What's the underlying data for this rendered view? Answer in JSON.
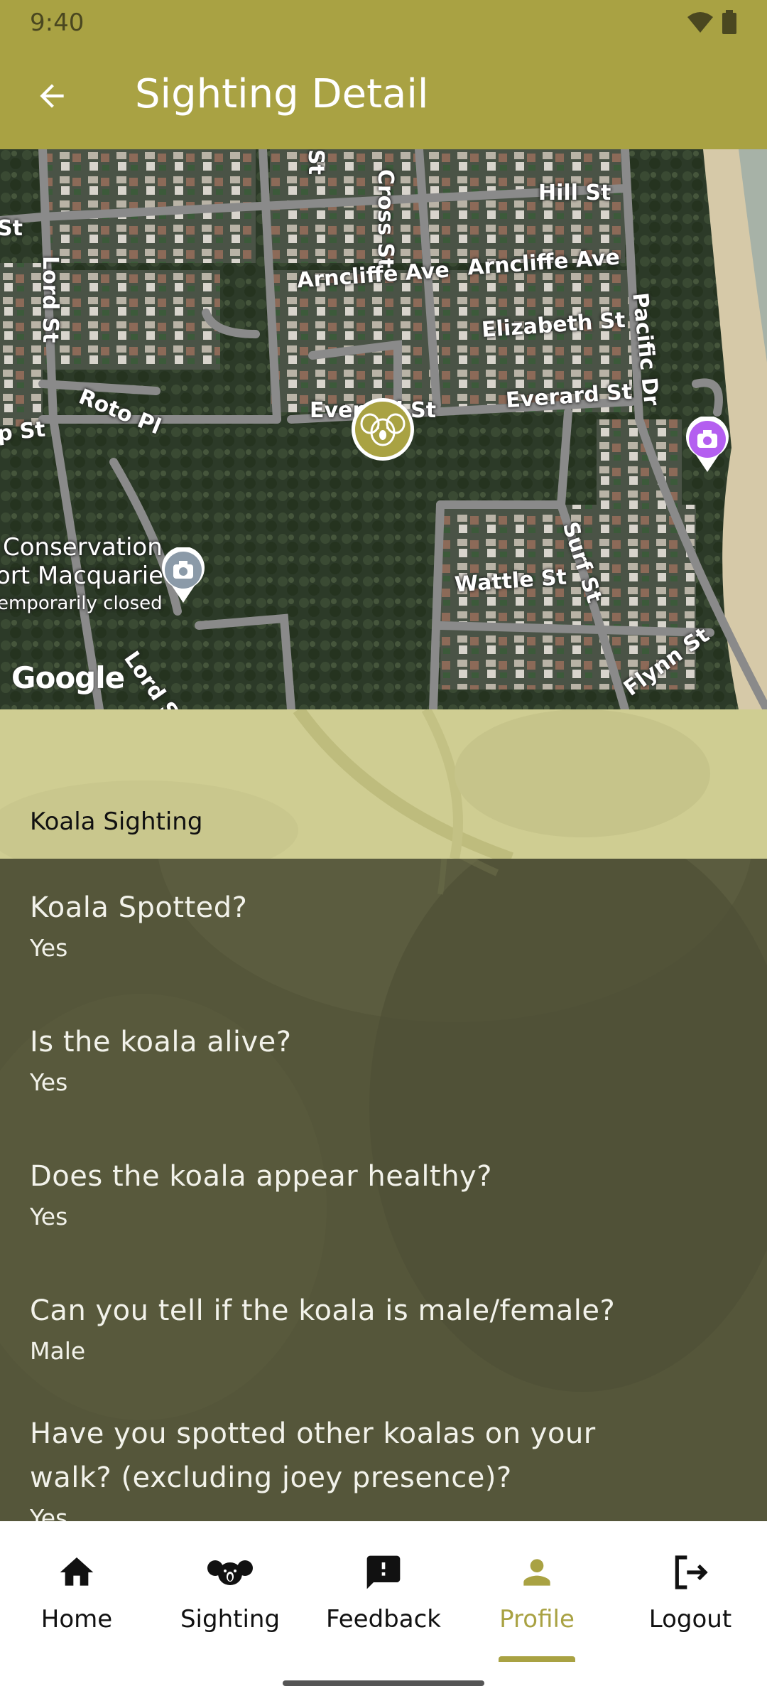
{
  "status_bar": {
    "time": "9:40"
  },
  "header": {
    "title": "Sighting Detail"
  },
  "map": {
    "labels": {
      "hill_st": "Hill St",
      "cross_st": "Cross St",
      "arncliffe_ave_1": "Arncliffe Ave",
      "arncliffe_ave_2": "Arncliffe Ave",
      "elizabeth_st": "Elizabeth St",
      "pacific_dr": "Pacific Dr",
      "lord_st_1": "Lord St",
      "lord_st_2": "Lord St",
      "roto_pl": "Roto Pl",
      "everard_st_1": "Everard St",
      "everard_st_2": "Everard St",
      "p_st": "p St",
      "wattle_st": "Wattle St",
      "surf_st": "Surf St",
      "flynn_st": "Flynn St",
      "st_left": "St",
      "st_top": "St",
      "poi_name_1": "Conservation",
      "poi_name_2": "ort Macquarie",
      "poi_status": "emporarily closed"
    },
    "attribution": "Google"
  },
  "section": {
    "title": "Koala Sighting"
  },
  "questions": [
    {
      "q": "Koala Spotted?",
      "a": "Yes"
    },
    {
      "q": "Is the koala alive?",
      "a": "Yes"
    },
    {
      "q": "Does the koala appear healthy?",
      "a": "Yes"
    },
    {
      "q": "Can you tell if the koala is male/female?",
      "a": "Male"
    },
    {
      "q": "Have you spotted other koalas on your walk? (excluding joey presence)?",
      "a": "Yes"
    }
  ],
  "nav": {
    "items": [
      {
        "label": "Home",
        "icon": "home-icon"
      },
      {
        "label": "Sighting",
        "icon": "koala-icon"
      },
      {
        "label": "Feedback",
        "icon": "feedback-icon"
      },
      {
        "label": "Profile",
        "icon": "person-icon"
      },
      {
        "label": "Logout",
        "icon": "logout-icon"
      }
    ],
    "active": "Profile"
  },
  "colors": {
    "primary": "#a9a243",
    "section_header": "#cfcd92",
    "content_bg": "#55563a",
    "poi_purple": "#b45ff0"
  }
}
